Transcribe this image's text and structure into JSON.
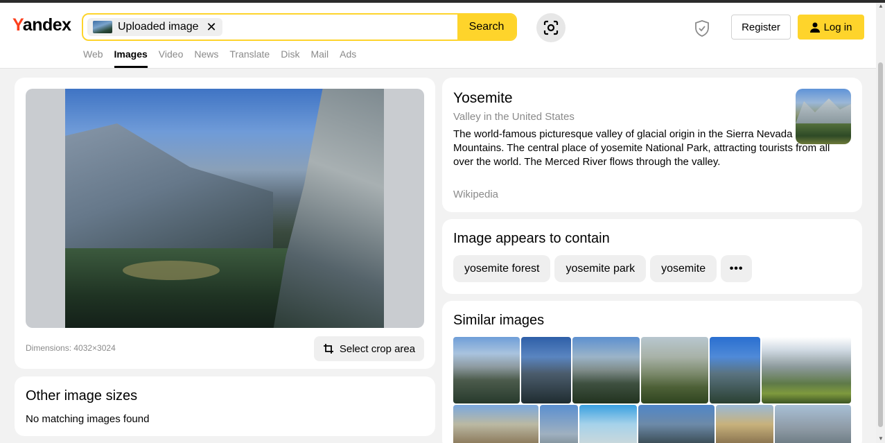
{
  "header": {
    "logo_y": "Y",
    "logo_rest": "andex",
    "search": {
      "chip_label": "Uploaded image",
      "chip_close": "✕",
      "button_label": "Search"
    },
    "register_label": "Register",
    "login_label": "Log in"
  },
  "nav": {
    "items": [
      {
        "label": "Web",
        "active": false
      },
      {
        "label": "Images",
        "active": true
      },
      {
        "label": "Video",
        "active": false
      },
      {
        "label": "News",
        "active": false
      },
      {
        "label": "Translate",
        "active": false
      },
      {
        "label": "Disk",
        "active": false
      },
      {
        "label": "Mail",
        "active": false
      },
      {
        "label": "Ads",
        "active": false
      }
    ]
  },
  "main_image": {
    "dimensions_text": "Dimensions: 4032×3024",
    "crop_label": "Select crop area"
  },
  "other_sizes": {
    "title": "Other image sizes",
    "text": "No matching images found"
  },
  "info": {
    "title": "Yosemite",
    "subtitle": "Valley in the United States",
    "description": "The world-famous picturesque valley of glacial origin in the Sierra Nevada Mountains. The central place of yosemite National Park, attracting tourists from all over the world. The Merced River flows through the valley.",
    "source": "Wikipedia"
  },
  "contains": {
    "title": "Image appears to contain",
    "tags": [
      "yosemite forest",
      "yosemite park",
      "yosemite"
    ],
    "more_label": "•••"
  },
  "similar": {
    "title": "Similar images"
  },
  "colors": {
    "accent_yellow": "#fed42b",
    "logo_red": "#fc3f1d",
    "muted_text": "#8a8a8a"
  }
}
